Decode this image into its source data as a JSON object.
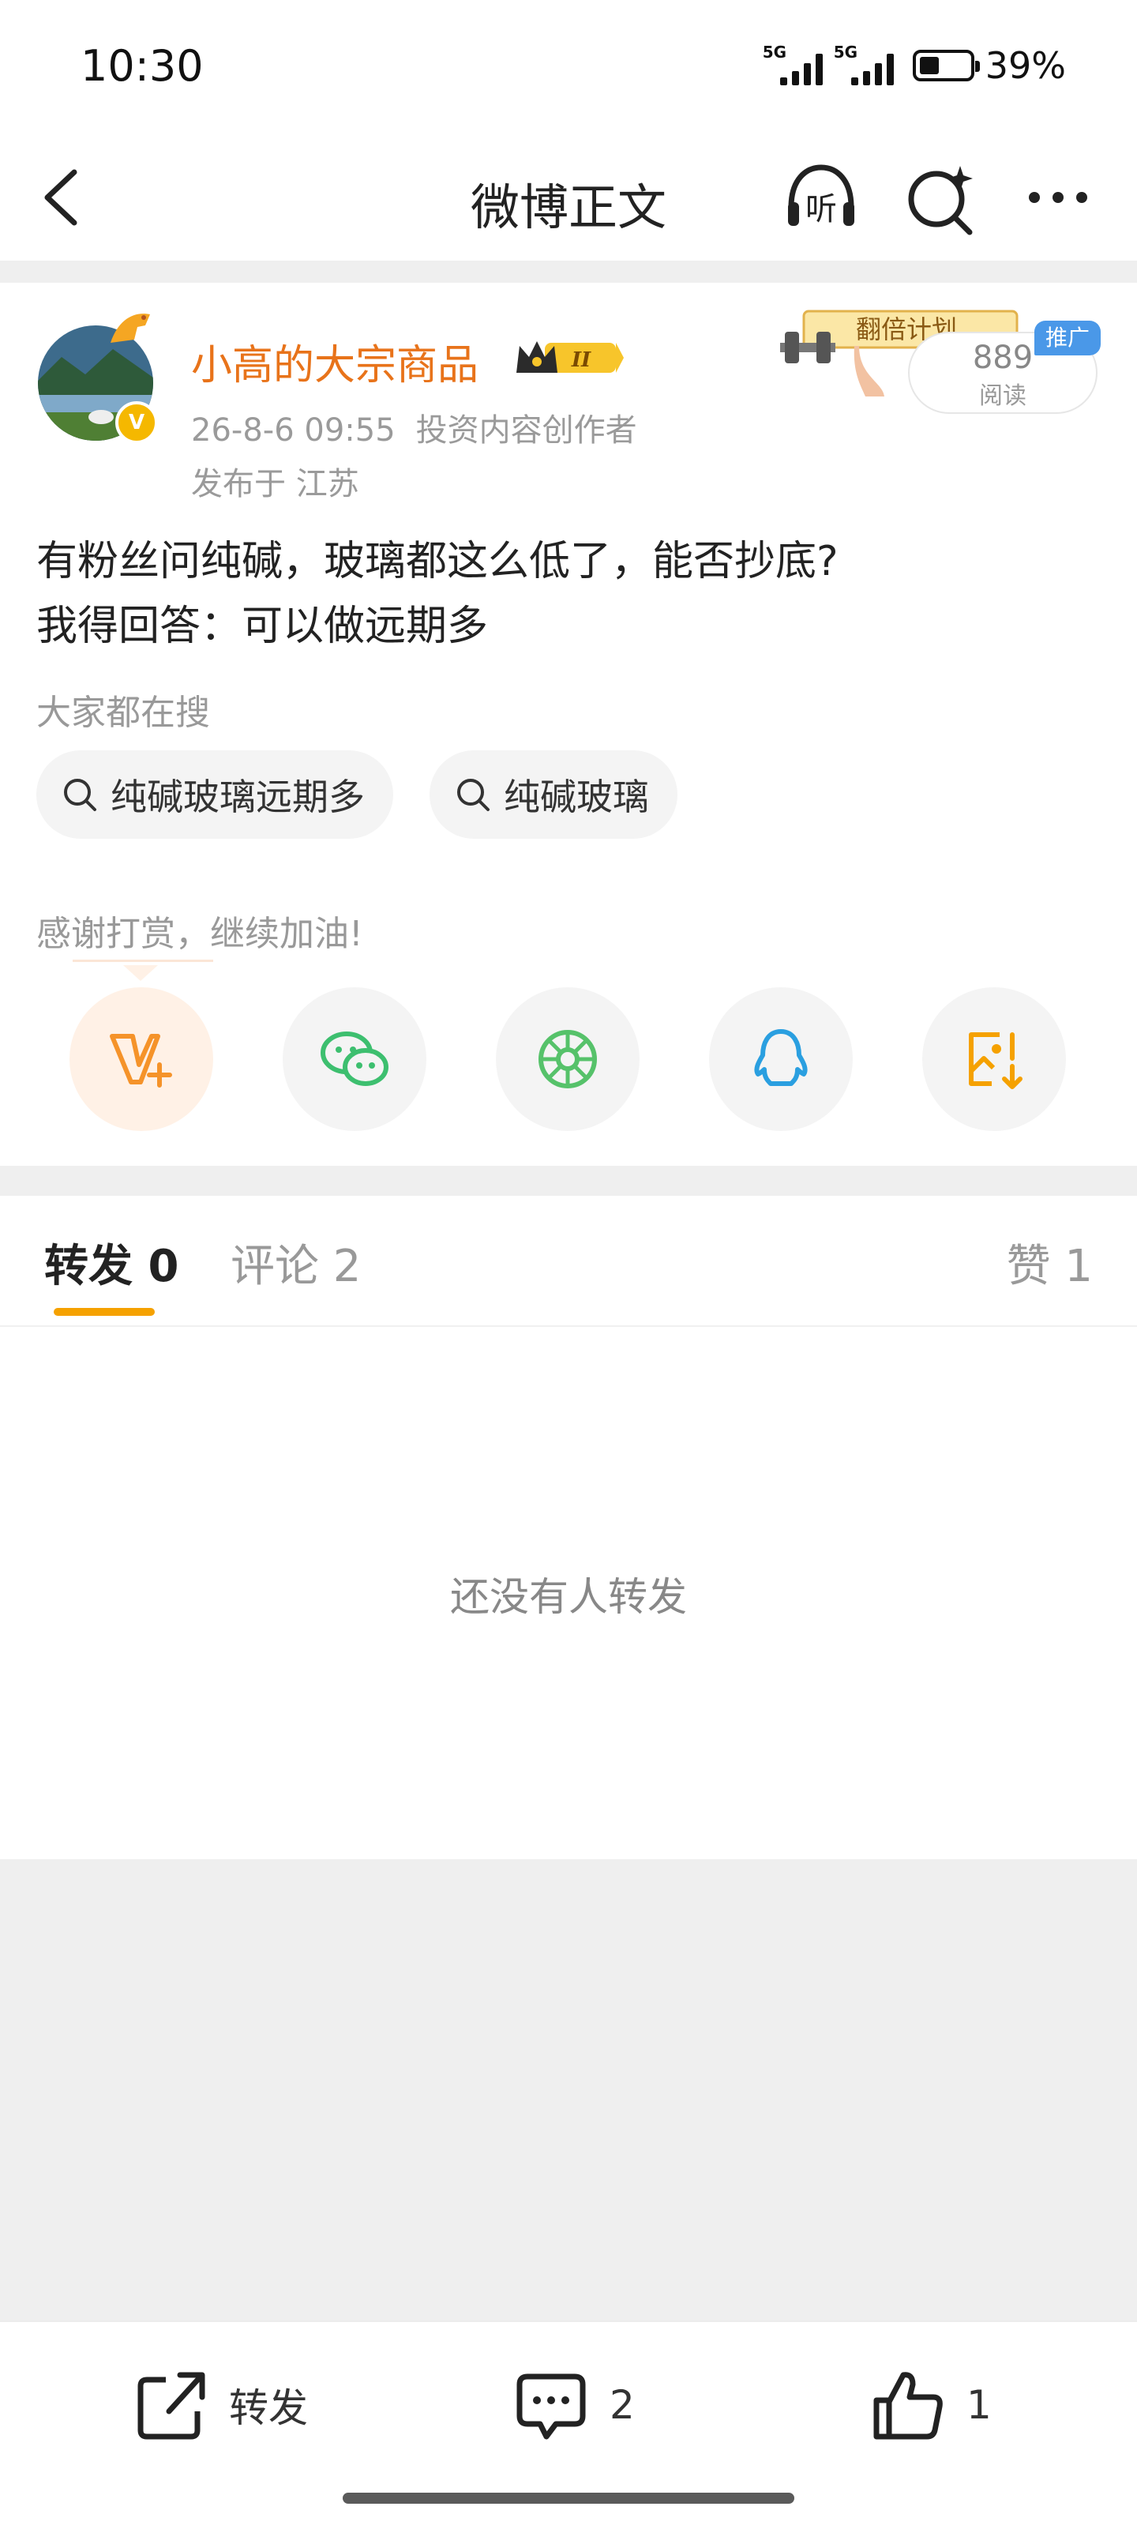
{
  "status_bar": {
    "time": "10:30",
    "signal1_label": "5G",
    "signal2_label": "5G",
    "battery_percent": "39%",
    "battery_level": 0.39
  },
  "header": {
    "title": "微博正文",
    "icons": [
      "back-icon",
      "listen-icon",
      "ai-search-icon",
      "more-icon"
    ],
    "listen_label": "听"
  },
  "post": {
    "author": "小高的大宗商品",
    "member_badge": "II",
    "time": "26-8-6 09:55",
    "role": "投资内容创作者",
    "location": "发布于 江苏",
    "lines": [
      "有粉丝问纯碱，玻璃都这么低了，能否抄底?",
      "我得回答：可以做远期多"
    ],
    "promo_banner": "翻倍计划",
    "reads_count": "889",
    "reads_label": "阅读",
    "ad_tag": "推广"
  },
  "search": {
    "title": "大家都在搜",
    "chips": [
      "纯碱玻璃远期多",
      "纯碱玻璃"
    ]
  },
  "reward": {
    "text": "感谢打赏，继续加油!",
    "share_targets": [
      "vplus-icon",
      "wechat-icon",
      "moments-icon",
      "qq-icon",
      "save-image-icon"
    ]
  },
  "tabs": {
    "repost": "转发 0",
    "comment": "评论 2",
    "like": "赞 1"
  },
  "empty_state": "还没有人转发",
  "toolbar": {
    "repost_label": "转发",
    "comment_count": "2",
    "like_count": "1"
  },
  "colors": {
    "accent_orange": "#f5a100",
    "author_orange": "#e8731a",
    "background_gray": "#efefef"
  }
}
